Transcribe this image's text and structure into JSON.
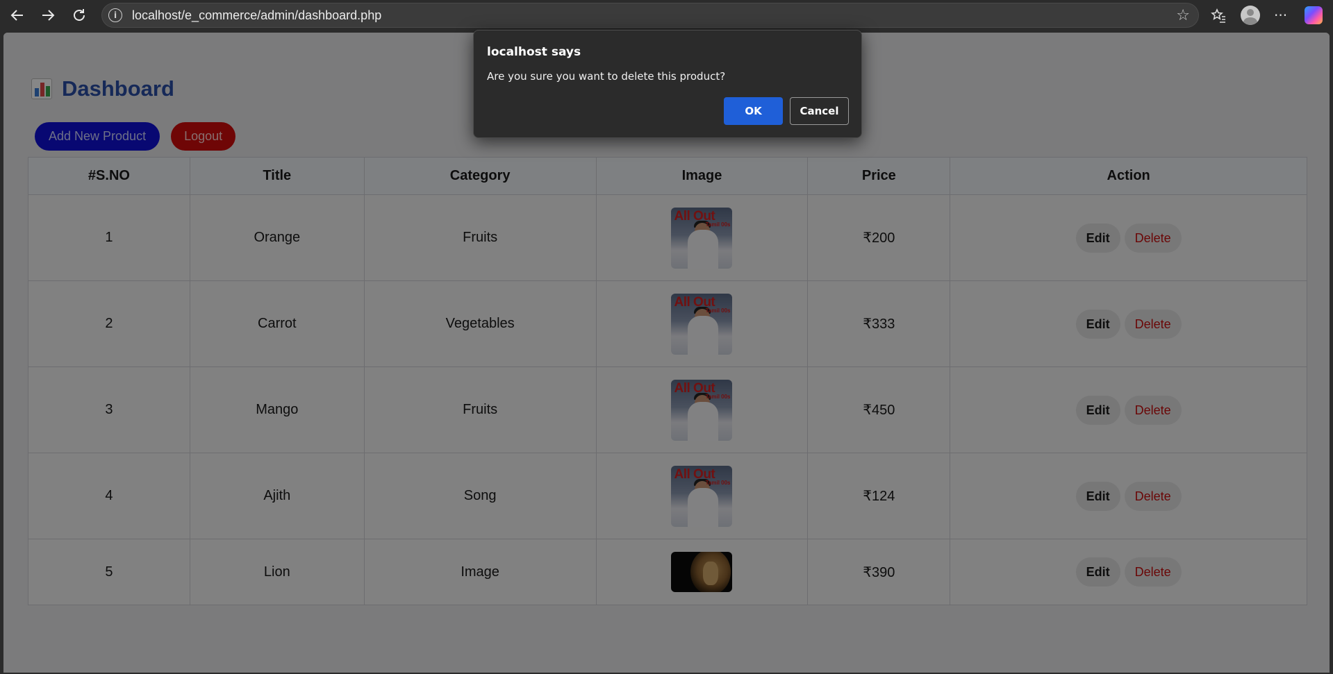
{
  "browser": {
    "url": "localhost/e_commerce/admin/dashboard.php",
    "icons": [
      "back-icon",
      "forward-icon",
      "refresh-icon",
      "info-icon",
      "star-icon",
      "favorites-icon",
      "profile-icon",
      "more-icon",
      "copilot-icon"
    ]
  },
  "page": {
    "title": "Dashboard",
    "add_label": "Add New Product",
    "logout_label": "Logout"
  },
  "table": {
    "headers": [
      "#S.NO",
      "Title",
      "Category",
      "Image",
      "Price",
      "Action"
    ],
    "edit_label": "Edit",
    "delete_label": "Delete",
    "rows": [
      {
        "sno": "1",
        "title": "Orange",
        "category": "Fruits",
        "price": "₹200"
      },
      {
        "sno": "2",
        "title": "Carrot",
        "category": "Vegetables",
        "price": "₹333"
      },
      {
        "sno": "3",
        "title": "Mango",
        "category": "Fruits",
        "price": "₹450"
      },
      {
        "sno": "4",
        "title": "Ajith",
        "category": "Song",
        "price": "₹124"
      },
      {
        "sno": "5",
        "title": "Lion",
        "category": "Image",
        "price": "₹390"
      }
    ],
    "thumb_text": {
      "line1": "All Out",
      "line2": "Tamil 00s"
    }
  },
  "dialog": {
    "title": "localhost says",
    "message": "Are you sure you want to delete this product?",
    "ok_label": "OK",
    "cancel_label": "Cancel"
  },
  "colors": {
    "accent": "#2b4fa6",
    "add_button": "#1010d8",
    "logout_button": "#d10c0c",
    "delete_text": "#c80e0e",
    "dialog_ok": "#1f5fd8"
  }
}
